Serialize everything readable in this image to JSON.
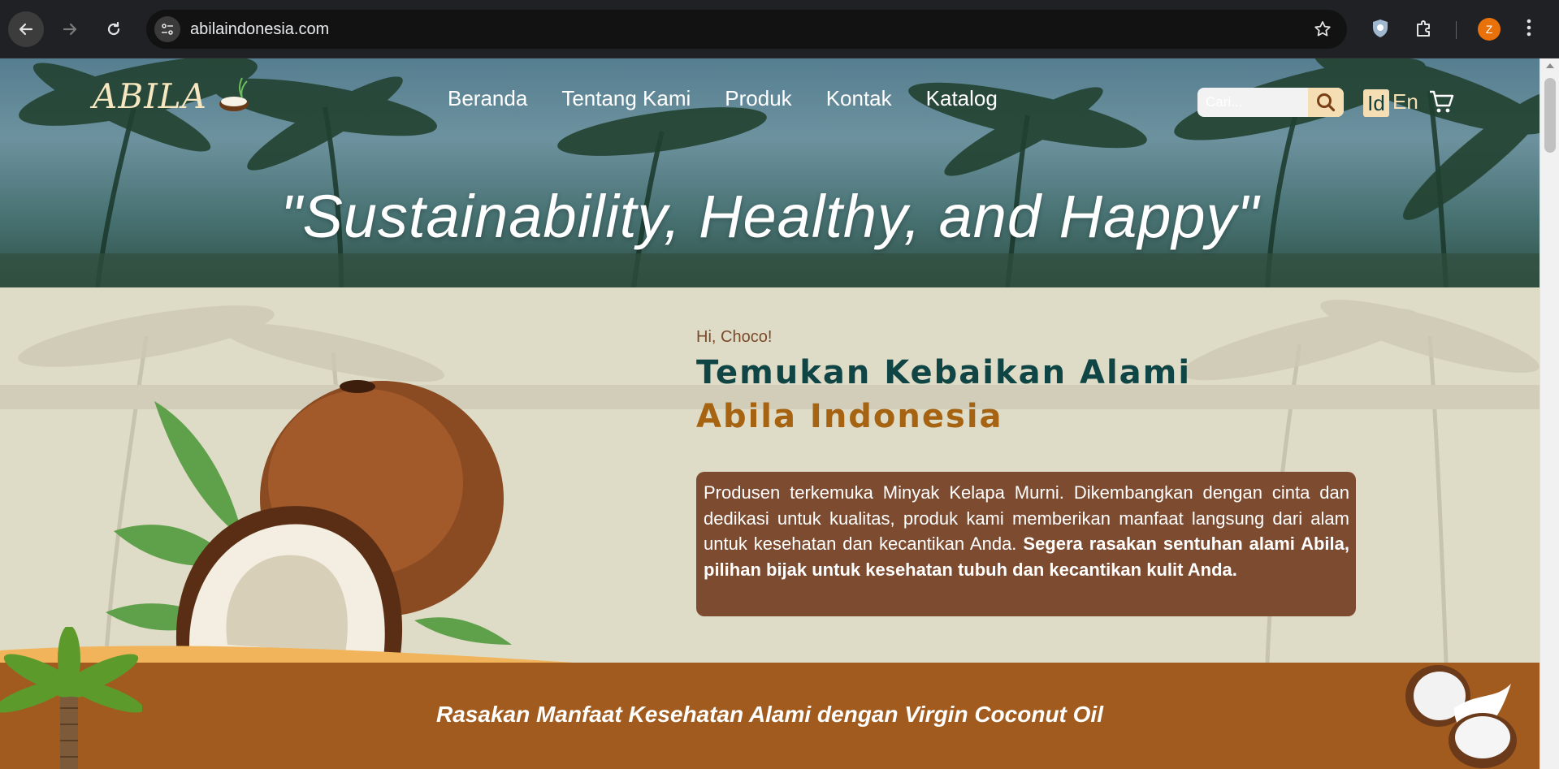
{
  "browser": {
    "url": "abilaindonesia.com",
    "profile_initial": "Z",
    "icons": [
      "back-arrow-icon",
      "forward-arrow-icon",
      "reload-icon",
      "site-info-icon",
      "bookmark-star-icon",
      "shield-extension-icon",
      "puzzle-extensions-icon",
      "kebab-menu-icon"
    ]
  },
  "header": {
    "logo_text": "ABILA",
    "nav": [
      "Beranda",
      "Tentang Kami",
      "Produk",
      "Kontak",
      "Katalog"
    ],
    "search_placeholder": "Cari...",
    "lang_id": "Id",
    "lang_en": "En"
  },
  "hero": {
    "tagline": "\"Sustainability, Healthy, and Happy\""
  },
  "about": {
    "greeting": "Hi, Choco!",
    "title_line1": "Temukan Kebaikan Alami",
    "title_line2": "Abila Indonesia",
    "description_plain": "Produsen terkemuka Minyak Kelapa Murni. Dikembangkan dengan cinta dan dedikasi untuk kualitas, produk kami memberikan manfaat langsung dari alam untuk kesehatan dan kecantikan Anda. ",
    "description_bold": "Segera rasakan sentuhan alami Abila, pilihan bijak untuk kesehatan tubuh dan kecantikan kulit Anda."
  },
  "banner": {
    "text": "Rasakan Manfaat Kesehatan Alami dengan Virgin Coconut Oil"
  },
  "colors": {
    "dark_teal": "#0f4545",
    "gold": "#a66311",
    "brown_box": "#7d4b2f",
    "band_orange": "#a15b1e",
    "cream": "#f5deb3"
  }
}
